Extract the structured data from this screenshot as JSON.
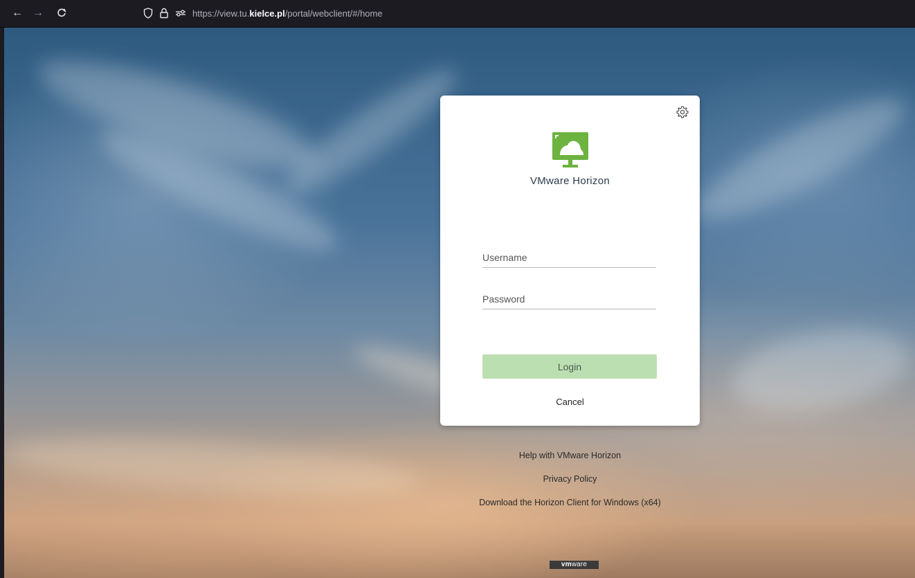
{
  "browser": {
    "back_label": "←",
    "forward_label": "→",
    "reload_label": "C",
    "url_prefix": "https://view.tu.",
    "url_host_highlight": "kielce.pl",
    "url_suffix": "/portal/webclient/#/home"
  },
  "login": {
    "app_name": "VMware Horizon",
    "username_placeholder": "Username",
    "password_placeholder": "Password",
    "login_label": "Login",
    "cancel_label": "Cancel",
    "accent_color": "#6cb33f",
    "button_color": "#bcdfb1"
  },
  "links": {
    "help": "Help with VMware Horizon",
    "privacy": "Privacy Policy",
    "download": "Download the Horizon Client for Windows (x64)"
  },
  "footer": {
    "brand_bold": "vm",
    "brand_rest": "ware"
  },
  "icons": {
    "settings": "gear-icon",
    "shield": "shield-icon",
    "lock": "lock-icon",
    "permissions": "permissions-icon",
    "logo": "monitor-cloud-icon"
  }
}
